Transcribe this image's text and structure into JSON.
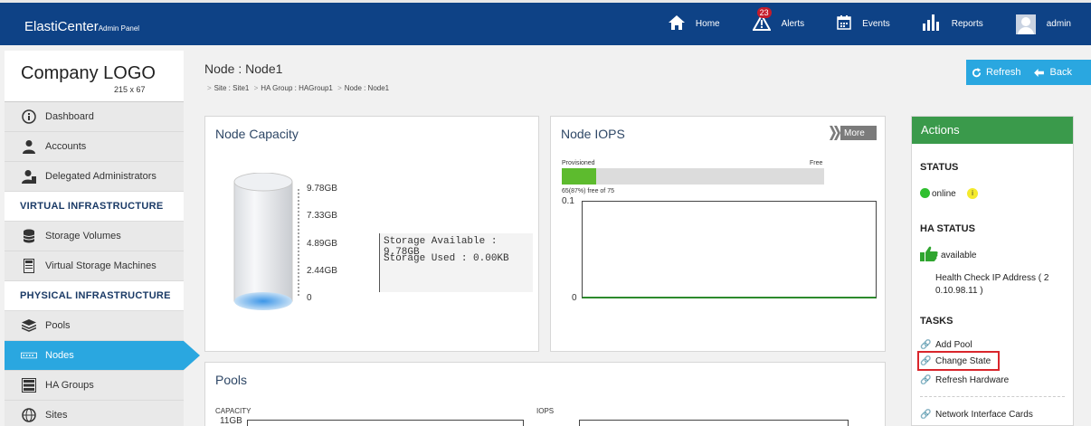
{
  "app": {
    "brand": "ElastiCenter",
    "brand_sub": "Admin Panel"
  },
  "topnav": {
    "home": "Home",
    "alerts": "Alerts",
    "alerts_count": "23",
    "events": "Events",
    "reports": "Reports",
    "user": "admin"
  },
  "sidebar": {
    "logo_title": "Company LOGO",
    "logo_size": "215 x 67",
    "items": [
      {
        "label": "Dashboard"
      },
      {
        "label": "Accounts"
      },
      {
        "label": "Delegated Administrators"
      }
    ],
    "section_virtual": "VIRTUAL INFRASTRUCTURE",
    "virtual_items": [
      {
        "label": "Storage Volumes"
      },
      {
        "label": "Virtual Storage Machines"
      }
    ],
    "section_physical": "PHYSICAL INFRASTRUCTURE",
    "physical_items": [
      {
        "label": "Pools"
      },
      {
        "label": "Nodes"
      },
      {
        "label": "HA Groups"
      },
      {
        "label": "Sites"
      }
    ]
  },
  "page": {
    "title": "Node : Node1",
    "breadcrumb": [
      "Site : Site1",
      "HA Group : HAGroup1",
      "Node : Node1"
    ],
    "refresh_label": "Refresh",
    "back_label": "Back"
  },
  "capacity": {
    "title": "Node Capacity",
    "ticks": [
      "9.78GB",
      "7.33GB",
      "4.89GB",
      "2.44GB",
      "0"
    ],
    "available": "Storage Available : 9.78GB",
    "used": "Storage Used : 0.00KB"
  },
  "iops": {
    "title": "Node IOPS",
    "more": "More",
    "provisioned_label": "Provisioned",
    "free_label": "Free",
    "provisioned_fraction": 0.13,
    "free_text": "65(87%) free of 75",
    "y_top": "0.1",
    "y_bottom": "0"
  },
  "pools": {
    "title": "Pools",
    "capacity_label": "CAPACITY",
    "capacity_value": "11GB",
    "iops_label": "IOPS"
  },
  "actions": {
    "title": "Actions",
    "status_head": "STATUS",
    "status_value": "online",
    "status_info": "i",
    "ha_head": "HA STATUS",
    "ha_value": "available",
    "health_check_1": "Health Check IP Address ( 2",
    "health_check_2": "0.10.98.11 )",
    "tasks_head": "TASKS",
    "tasks": [
      {
        "label": "Add Pool"
      },
      {
        "label": "Change State"
      },
      {
        "label": "Refresh Hardware"
      },
      {
        "label": "Network Interface Cards"
      }
    ]
  },
  "colors": {
    "accent": "#2aa7e0",
    "header": "#0e4286",
    "actions": "#3a9a4b",
    "online": "#2fbf2f",
    "highlight": "#d9262c"
  }
}
